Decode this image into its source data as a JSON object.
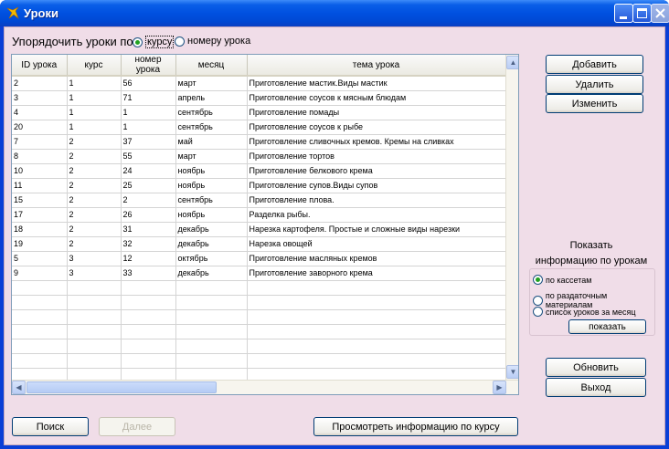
{
  "window": {
    "title": "Уроки",
    "icon": "app-icon"
  },
  "sort": {
    "label": "Упорядочить уроки по:",
    "options": [
      {
        "label": "курсу",
        "checked": true
      },
      {
        "label": "номеру урока",
        "checked": false
      }
    ]
  },
  "grid": {
    "columns": [
      "ID урока",
      "курс",
      "номер урока",
      "месяц",
      "тема урока"
    ],
    "rows": [
      [
        "2",
        "1",
        "56",
        "март",
        "Приготовление мастик.Виды мастик"
      ],
      [
        "3",
        "1",
        "71",
        "апрель",
        "Приготовление соусов к мясным блюдам"
      ],
      [
        "4",
        "1",
        "1",
        "сентябрь",
        "Приготовление помады"
      ],
      [
        "20",
        "1",
        "1",
        "сентябрь",
        "Приготовление соусов к рыбе"
      ],
      [
        "7",
        "2",
        "37",
        "май",
        "Приготовление сливочных кремов. Кремы на сливках"
      ],
      [
        "8",
        "2",
        "55",
        "март",
        "Приготовление тортов"
      ],
      [
        "10",
        "2",
        "24",
        "ноябрь",
        "Приготовление белкового крема"
      ],
      [
        "11",
        "2",
        "25",
        "ноябрь",
        "Приготовление супов.Виды супов"
      ],
      [
        "15",
        "2",
        "2",
        "сентябрь",
        "Приготовление плова."
      ],
      [
        "17",
        "2",
        "26",
        "ноябрь",
        "Разделка рыбы."
      ],
      [
        "18",
        "2",
        "31",
        "декабрь",
        "Нарезка картофеля. Простые и сложные виды нарезки"
      ],
      [
        "19",
        "2",
        "32",
        "декабрь",
        "Нарезка овощей"
      ],
      [
        "5",
        "3",
        "12",
        "октябрь",
        "Приготовление масляных кремов"
      ],
      [
        "9",
        "3",
        "33",
        "декабрь",
        "Приготовление заворного крема"
      ]
    ]
  },
  "right_buttons": {
    "add": "Добавить",
    "delete": "Удалить",
    "edit": "Изменить"
  },
  "info": {
    "caption_line1": "Показать",
    "caption_line2": "информацию по урокам",
    "options": [
      {
        "label": "по кассетам",
        "checked": true
      },
      {
        "label": "по раздаточным материалам",
        "checked": false
      },
      {
        "label": "список уроков за месяц",
        "checked": false
      }
    ],
    "show_button": "показать"
  },
  "bottom_right": {
    "refresh": "Обновить",
    "exit": "Выход"
  },
  "bottom": {
    "search": "Поиск",
    "next": "Далее",
    "course_info": "Просмотреть информацию по курсу"
  },
  "colors": {
    "title_bar": "#0050e0",
    "client_bg": "#f0dde8",
    "radio_checked": "#21a121"
  }
}
